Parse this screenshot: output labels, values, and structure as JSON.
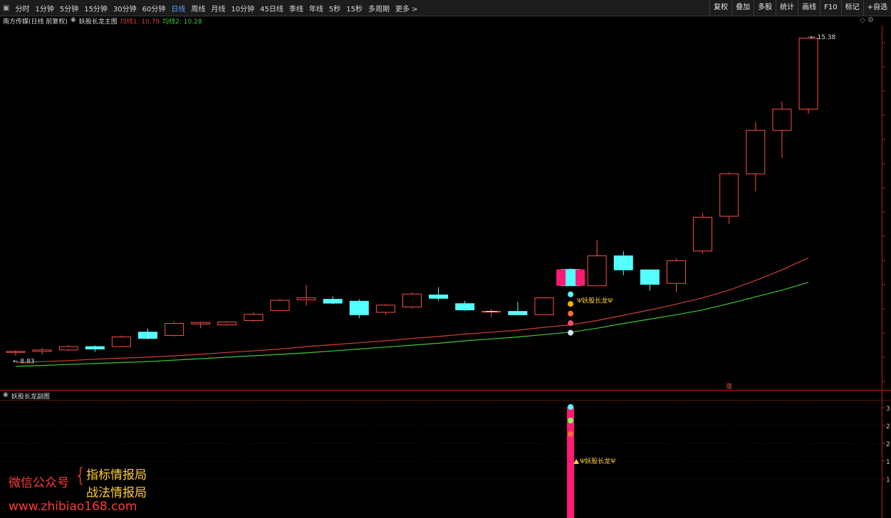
{
  "toolbar": {
    "periods": [
      "分时",
      "1分钟",
      "5分钟",
      "15分钟",
      "30分钟",
      "60分钟",
      "日线",
      "周线",
      "月线",
      "10分钟",
      "45日线",
      "季线",
      "年线",
      "5秒",
      "15秒",
      "多周期",
      "更多 >"
    ],
    "active_period": "日线",
    "right_buttons": [
      "复权",
      "叠加",
      "多股",
      "统计",
      "画线",
      "F10",
      "标记",
      "+自选"
    ]
  },
  "main_panel": {
    "stock_name": "南方传媒(日线 前复权)",
    "indicator_name": "妖股长龙主图",
    "ma1_label": "均线1: 10.79",
    "ma2_label": "均线2: 10.28",
    "high_label": "15.38",
    "low_label": "8.83",
    "signal_text": "Ψ妖股长龙Ψ",
    "corner_mark": "涨"
  },
  "sub_panel": {
    "indicator_name": "妖股长龙副图",
    "signal_text": "Ψ妖股长龙Ψ"
  },
  "watermark": {
    "left_label": "微信公众号",
    "line1": "指标情报局",
    "line2": "战法情报局",
    "url": "www.zhibiao168.com"
  },
  "colors": {
    "up": "#ff4d4d",
    "down": "#54ffff",
    "ma1": "#d23c3c",
    "ma2": "#3cc83c",
    "signal_bar": "#ff1a75"
  },
  "chart_data": {
    "type": "candlestick",
    "price_range": [
      8.2,
      15.6
    ],
    "candles": [
      {
        "o": 8.83,
        "h": 8.88,
        "l": 8.76,
        "c": 8.85
      },
      {
        "o": 8.85,
        "h": 8.92,
        "l": 8.78,
        "c": 8.88
      },
      {
        "o": 8.88,
        "h": 8.98,
        "l": 8.86,
        "c": 8.95
      },
      {
        "o": 8.95,
        "h": 8.97,
        "l": 8.84,
        "c": 8.9
      },
      {
        "o": 8.95,
        "h": 9.18,
        "l": 8.94,
        "c": 9.15
      },
      {
        "o": 9.25,
        "h": 9.32,
        "l": 9.1,
        "c": 9.12
      },
      {
        "o": 9.18,
        "h": 9.47,
        "l": 9.16,
        "c": 9.43
      },
      {
        "o": 9.42,
        "h": 9.47,
        "l": 9.33,
        "c": 9.45
      },
      {
        "o": 9.4,
        "h": 9.48,
        "l": 9.38,
        "c": 9.46
      },
      {
        "o": 9.49,
        "h": 9.66,
        "l": 9.46,
        "c": 9.62
      },
      {
        "o": 9.7,
        "h": 9.94,
        "l": 9.69,
        "c": 9.91
      },
      {
        "o": 9.92,
        "h": 10.23,
        "l": 9.8,
        "c": 9.96
      },
      {
        "o": 9.93,
        "h": 9.99,
        "l": 9.83,
        "c": 9.85
      },
      {
        "o": 9.89,
        "h": 9.93,
        "l": 9.54,
        "c": 9.61
      },
      {
        "o": 9.66,
        "h": 9.83,
        "l": 9.61,
        "c": 9.81
      },
      {
        "o": 9.77,
        "h": 10.07,
        "l": 9.74,
        "c": 10.04
      },
      {
        "o": 10.02,
        "h": 10.18,
        "l": 9.9,
        "c": 9.95
      },
      {
        "o": 9.84,
        "h": 9.9,
        "l": 9.69,
        "c": 9.71
      },
      {
        "o": 9.68,
        "h": 9.73,
        "l": 9.56,
        "c": 9.68
      },
      {
        "o": 9.68,
        "h": 9.88,
        "l": 9.62,
        "c": 9.61
      },
      {
        "o": 9.61,
        "h": 9.98,
        "l": 9.61,
        "c": 9.96
      },
      {
        "o": 10.55,
        "h": 10.57,
        "l": 10.21,
        "c": 10.21
      },
      {
        "o": 10.21,
        "h": 11.16,
        "l": 10.21,
        "c": 10.83
      },
      {
        "o": 10.83,
        "h": 10.93,
        "l": 10.43,
        "c": 10.54
      },
      {
        "o": 10.54,
        "h": 10.54,
        "l": 10.11,
        "c": 10.24
      },
      {
        "o": 10.26,
        "h": 10.78,
        "l": 10.08,
        "c": 10.73
      },
      {
        "o": 10.93,
        "h": 11.71,
        "l": 10.87,
        "c": 11.63
      },
      {
        "o": 11.65,
        "h": 12.56,
        "l": 11.49,
        "c": 12.53
      },
      {
        "o": 12.53,
        "h": 13.6,
        "l": 12.17,
        "c": 13.43
      },
      {
        "o": 13.43,
        "h": 14.03,
        "l": 12.86,
        "c": 13.87
      },
      {
        "o": 13.87,
        "h": 15.38,
        "l": 13.77,
        "c": 15.34
      }
    ],
    "ma1": [
      8.62,
      8.64,
      8.66,
      8.69,
      8.71,
      8.73,
      8.76,
      8.79,
      8.83,
      8.86,
      8.9,
      8.95,
      8.99,
      9.03,
      9.07,
      9.12,
      9.16,
      9.21,
      9.25,
      9.29,
      9.35,
      9.4,
      9.49,
      9.6,
      9.71,
      9.83,
      9.96,
      10.12,
      10.32,
      10.54,
      10.79
    ],
    "ma2": [
      8.54,
      8.56,
      8.58,
      8.6,
      8.62,
      8.64,
      8.67,
      8.7,
      8.73,
      8.76,
      8.79,
      8.82,
      8.86,
      8.9,
      8.94,
      8.98,
      9.02,
      9.07,
      9.11,
      9.15,
      9.2,
      9.25,
      9.33,
      9.43,
      9.52,
      9.61,
      9.71,
      9.84,
      9.98,
      10.12,
      10.28
    ],
    "sub_axis_labels": [
      "3",
      "2",
      "2",
      "1",
      "1"
    ]
  }
}
